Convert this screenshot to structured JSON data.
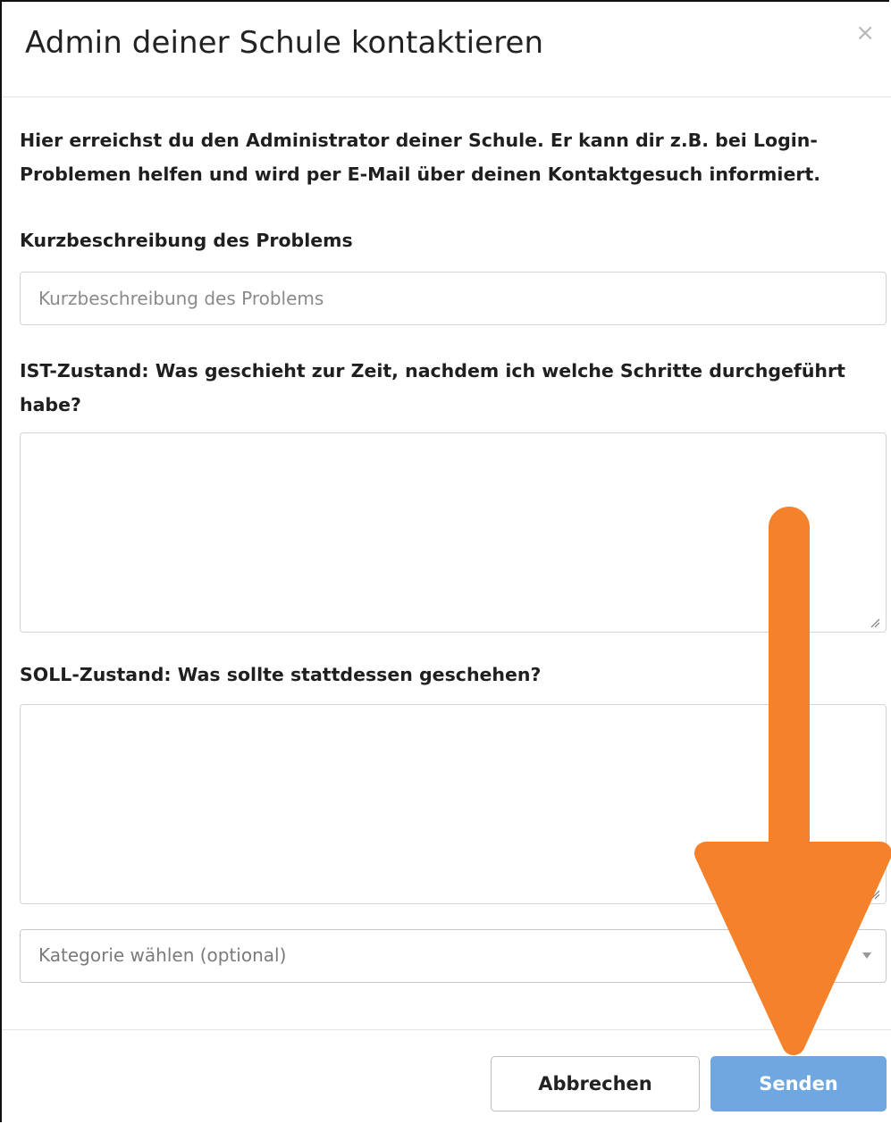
{
  "modal": {
    "title": "Admin deiner Schule kontaktieren",
    "close_glyph": "×",
    "intro": "Hier erreichst du den Administrator deiner Schule. Er kann dir z.B. bei Login-Problemen helfen und wird per E-Mail über deinen Kontaktgesuch informiert."
  },
  "form": {
    "summary_label": "Kurzbeschreibung des Problems",
    "summary_placeholder": "Kurzbeschreibung des Problems",
    "summary_value": "",
    "current_state_label": "IST-Zustand: Was geschieht zur Zeit, nachdem ich welche Schritte durchgeführt habe?",
    "current_state_value": "",
    "target_state_label": "SOLL-Zustand: Was sollte stattdessen geschehen?",
    "target_state_value": "",
    "category_placeholder": "Kategorie wählen (optional)"
  },
  "footer": {
    "cancel_label": "Abbrechen",
    "send_label": "Senden"
  },
  "annotation": {
    "arrow_color": "#f5822a",
    "points_to": "send-button"
  },
  "colors": {
    "send_button": "#6fa8e0",
    "close_icon": "#b8b8b8"
  }
}
